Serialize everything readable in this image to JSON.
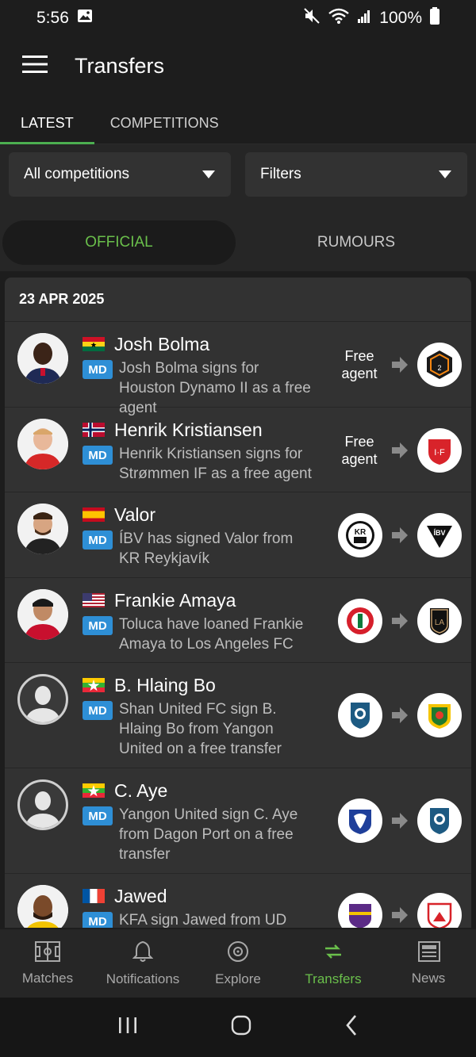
{
  "status_bar": {
    "time": "5:56",
    "battery": "100%"
  },
  "app_bar": {
    "title": "Transfers"
  },
  "tabs": [
    {
      "label": "LATEST",
      "active": true
    },
    {
      "label": "COMPETITIONS",
      "active": false
    }
  ],
  "filters": {
    "competitions_label": "All competitions",
    "filters_label": "Filters"
  },
  "segments": {
    "official": "OFFICIAL",
    "rumours": "RUMOURS"
  },
  "date_header": "23 APR 2025",
  "transfers": [
    {
      "name": "Josh Bolma",
      "badge": "MD",
      "description": "Josh Bolma signs for Houston Dynamo II as a free agent",
      "from": "Free agent",
      "to_icon": "houston-dynamo-2-crest-icon",
      "flag": "ghana"
    },
    {
      "name": "Henrik Kristiansen",
      "badge": "MD",
      "description": "Henrik Kristiansen signs for Strømmen IF as a free agent",
      "from": "Free agent",
      "to_icon": "strommen-if-crest-icon",
      "flag": "norway"
    },
    {
      "name": "Valor",
      "badge": "MD",
      "description": "ÍBV has signed Valor from KR Reykjavík",
      "from_icon": "kr-reykjavik-crest-icon",
      "to_icon": "ibv-crest-icon",
      "flag": "spain"
    },
    {
      "name": "Frankie Amaya",
      "badge": "MD",
      "description": "Toluca have loaned Frankie Amaya to Los Angeles FC",
      "from_icon": "toluca-crest-icon",
      "to_icon": "lafc-crest-icon",
      "flag": "usa"
    },
    {
      "name": "B. Hlaing Bo",
      "badge": "MD",
      "description": "Shan United FC sign B. Hlaing Bo from Yangon United on a free transfer",
      "from_icon": "shan-united-crest-icon",
      "to_icon": "yangon-united-crest-icon",
      "flag": "myanmar"
    },
    {
      "name": "C. Aye",
      "badge": "MD",
      "description": "Yangon United sign C. Aye from Dagon Port on a free transfer",
      "from_icon": "dagon-port-crest-icon",
      "to_icon": "shan-united-crest-icon",
      "flag": "myanmar"
    },
    {
      "name": "Jawed",
      "badge": "MD",
      "description": "KFA sign Jawed from UD",
      "from_icon": "ud-crest-icon",
      "to_icon": "kfa-crest-icon",
      "flag": "france"
    }
  ],
  "bottom_nav": [
    {
      "label": "Matches",
      "icon": "pitch-icon",
      "active": false
    },
    {
      "label": "Notifications",
      "icon": "bell-icon",
      "active": false
    },
    {
      "label": "Explore",
      "icon": "compass-icon",
      "active": false
    },
    {
      "label": "Transfers",
      "icon": "transfer-arrows-icon",
      "active": true
    },
    {
      "label": "News",
      "icon": "newspaper-icon",
      "active": false
    }
  ],
  "colors": {
    "accent_green": "#4caf50",
    "badge_blue": "#2e8fd6",
    "background": "#1d1d1d"
  }
}
